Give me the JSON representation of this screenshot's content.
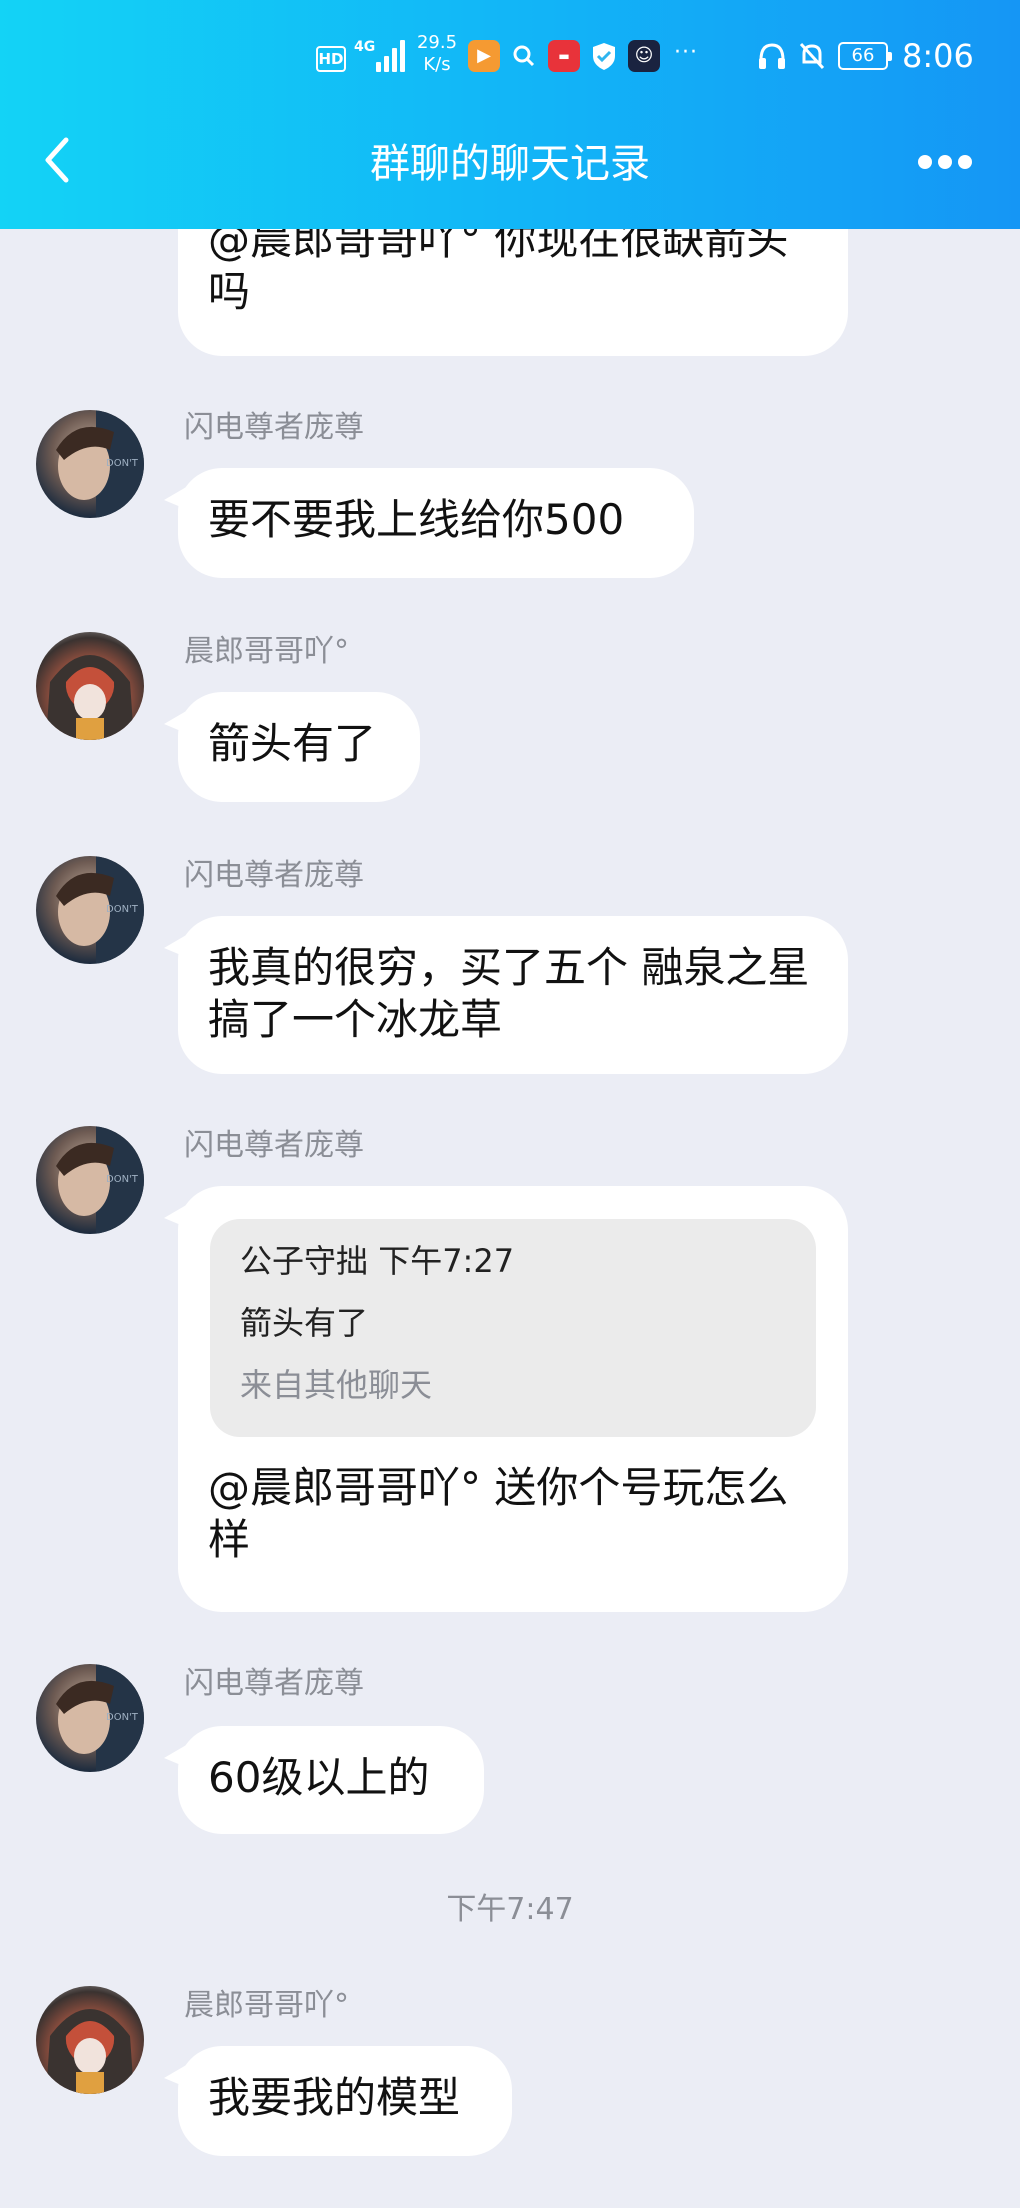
{
  "status_bar": {
    "hd": "HD",
    "network": "4G",
    "speed_value": "29.5",
    "speed_unit": "K/s",
    "more": "···",
    "battery": "66",
    "time": "8:06"
  },
  "nav": {
    "title": "群聊的聊天记录"
  },
  "messages": [
    {
      "sender": "",
      "text": "@晨郎哥哥吖° 你现在很缺箭头吗"
    },
    {
      "sender": "闪电尊者庞尊",
      "text": "要不要我上线给你500"
    },
    {
      "sender": "晨郎哥哥吖°",
      "text": "箭头有了"
    },
    {
      "sender": "闪电尊者庞尊",
      "text": "我真的很穷，买了五个 融泉之星搞了一个冰龙草"
    },
    {
      "sender": "闪电尊者庞尊",
      "quote": {
        "author": "公子守拙",
        "time": "下午7:27",
        "text": "箭头有了",
        "source": "来自其他聊天"
      },
      "text": "@晨郎哥哥吖° 送你个号玩怎么样"
    },
    {
      "sender": "闪电尊者庞尊",
      "text": "60级以上的"
    },
    {
      "sender": "晨郎哥哥吖°",
      "text": "我要我的模型"
    }
  ],
  "timestamp": "下午7:47",
  "colors": {
    "header_start": "#13d3f6",
    "header_end": "#1596f5",
    "background": "#ebedf5",
    "bubble": "#ffffff",
    "sender_name": "#8b8e96"
  }
}
